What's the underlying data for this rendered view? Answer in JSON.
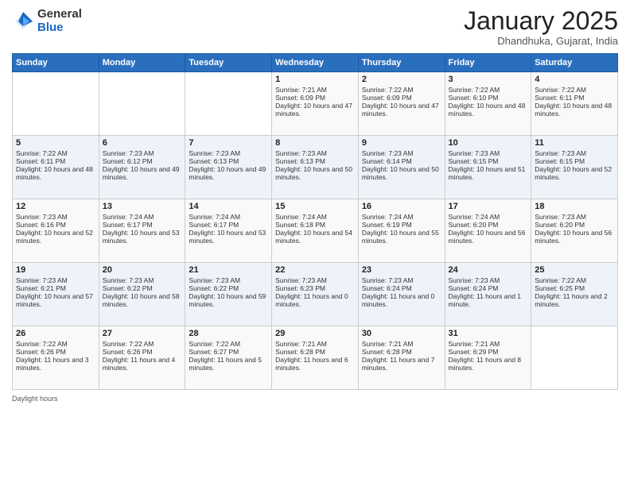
{
  "header": {
    "logo_general": "General",
    "logo_blue": "Blue",
    "month_title": "January 2025",
    "location": "Dhandhuka, Gujarat, India"
  },
  "weekdays": [
    "Sunday",
    "Monday",
    "Tuesday",
    "Wednesday",
    "Thursday",
    "Friday",
    "Saturday"
  ],
  "weeks": [
    [
      {
        "day": "",
        "sunrise": "",
        "sunset": "",
        "daylight": ""
      },
      {
        "day": "",
        "sunrise": "",
        "sunset": "",
        "daylight": ""
      },
      {
        "day": "",
        "sunrise": "",
        "sunset": "",
        "daylight": ""
      },
      {
        "day": "1",
        "sunrise": "Sunrise: 7:21 AM",
        "sunset": "Sunset: 6:09 PM",
        "daylight": "Daylight: 10 hours and 47 minutes."
      },
      {
        "day": "2",
        "sunrise": "Sunrise: 7:22 AM",
        "sunset": "Sunset: 6:09 PM",
        "daylight": "Daylight: 10 hours and 47 minutes."
      },
      {
        "day": "3",
        "sunrise": "Sunrise: 7:22 AM",
        "sunset": "Sunset: 6:10 PM",
        "daylight": "Daylight: 10 hours and 48 minutes."
      },
      {
        "day": "4",
        "sunrise": "Sunrise: 7:22 AM",
        "sunset": "Sunset: 6:11 PM",
        "daylight": "Daylight: 10 hours and 48 minutes."
      }
    ],
    [
      {
        "day": "5",
        "sunrise": "Sunrise: 7:22 AM",
        "sunset": "Sunset: 6:11 PM",
        "daylight": "Daylight: 10 hours and 48 minutes."
      },
      {
        "day": "6",
        "sunrise": "Sunrise: 7:23 AM",
        "sunset": "Sunset: 6:12 PM",
        "daylight": "Daylight: 10 hours and 49 minutes."
      },
      {
        "day": "7",
        "sunrise": "Sunrise: 7:23 AM",
        "sunset": "Sunset: 6:13 PM",
        "daylight": "Daylight: 10 hours and 49 minutes."
      },
      {
        "day": "8",
        "sunrise": "Sunrise: 7:23 AM",
        "sunset": "Sunset: 6:13 PM",
        "daylight": "Daylight: 10 hours and 50 minutes."
      },
      {
        "day": "9",
        "sunrise": "Sunrise: 7:23 AM",
        "sunset": "Sunset: 6:14 PM",
        "daylight": "Daylight: 10 hours and 50 minutes."
      },
      {
        "day": "10",
        "sunrise": "Sunrise: 7:23 AM",
        "sunset": "Sunset: 6:15 PM",
        "daylight": "Daylight: 10 hours and 51 minutes."
      },
      {
        "day": "11",
        "sunrise": "Sunrise: 7:23 AM",
        "sunset": "Sunset: 6:15 PM",
        "daylight": "Daylight: 10 hours and 52 minutes."
      }
    ],
    [
      {
        "day": "12",
        "sunrise": "Sunrise: 7:23 AM",
        "sunset": "Sunset: 6:16 PM",
        "daylight": "Daylight: 10 hours and 52 minutes."
      },
      {
        "day": "13",
        "sunrise": "Sunrise: 7:24 AM",
        "sunset": "Sunset: 6:17 PM",
        "daylight": "Daylight: 10 hours and 53 minutes."
      },
      {
        "day": "14",
        "sunrise": "Sunrise: 7:24 AM",
        "sunset": "Sunset: 6:17 PM",
        "daylight": "Daylight: 10 hours and 53 minutes."
      },
      {
        "day": "15",
        "sunrise": "Sunrise: 7:24 AM",
        "sunset": "Sunset: 6:18 PM",
        "daylight": "Daylight: 10 hours and 54 minutes."
      },
      {
        "day": "16",
        "sunrise": "Sunrise: 7:24 AM",
        "sunset": "Sunset: 6:19 PM",
        "daylight": "Daylight: 10 hours and 55 minutes."
      },
      {
        "day": "17",
        "sunrise": "Sunrise: 7:24 AM",
        "sunset": "Sunset: 6:20 PM",
        "daylight": "Daylight: 10 hours and 56 minutes."
      },
      {
        "day": "18",
        "sunrise": "Sunrise: 7:23 AM",
        "sunset": "Sunset: 6:20 PM",
        "daylight": "Daylight: 10 hours and 56 minutes."
      }
    ],
    [
      {
        "day": "19",
        "sunrise": "Sunrise: 7:23 AM",
        "sunset": "Sunset: 6:21 PM",
        "daylight": "Daylight: 10 hours and 57 minutes."
      },
      {
        "day": "20",
        "sunrise": "Sunrise: 7:23 AM",
        "sunset": "Sunset: 6:22 PM",
        "daylight": "Daylight: 10 hours and 58 minutes."
      },
      {
        "day": "21",
        "sunrise": "Sunrise: 7:23 AM",
        "sunset": "Sunset: 6:22 PM",
        "daylight": "Daylight: 10 hours and 59 minutes."
      },
      {
        "day": "22",
        "sunrise": "Sunrise: 7:23 AM",
        "sunset": "Sunset: 6:23 PM",
        "daylight": "Daylight: 11 hours and 0 minutes."
      },
      {
        "day": "23",
        "sunrise": "Sunrise: 7:23 AM",
        "sunset": "Sunset: 6:24 PM",
        "daylight": "Daylight: 11 hours and 0 minutes."
      },
      {
        "day": "24",
        "sunrise": "Sunrise: 7:23 AM",
        "sunset": "Sunset: 6:24 PM",
        "daylight": "Daylight: 11 hours and 1 minute."
      },
      {
        "day": "25",
        "sunrise": "Sunrise: 7:22 AM",
        "sunset": "Sunset: 6:25 PM",
        "daylight": "Daylight: 11 hours and 2 minutes."
      }
    ],
    [
      {
        "day": "26",
        "sunrise": "Sunrise: 7:22 AM",
        "sunset": "Sunset: 6:26 PM",
        "daylight": "Daylight: 11 hours and 3 minutes."
      },
      {
        "day": "27",
        "sunrise": "Sunrise: 7:22 AM",
        "sunset": "Sunset: 6:26 PM",
        "daylight": "Daylight: 11 hours and 4 minutes."
      },
      {
        "day": "28",
        "sunrise": "Sunrise: 7:22 AM",
        "sunset": "Sunset: 6:27 PM",
        "daylight": "Daylight: 11 hours and 5 minutes."
      },
      {
        "day": "29",
        "sunrise": "Sunrise: 7:21 AM",
        "sunset": "Sunset: 6:28 PM",
        "daylight": "Daylight: 11 hours and 6 minutes."
      },
      {
        "day": "30",
        "sunrise": "Sunrise: 7:21 AM",
        "sunset": "Sunset: 6:28 PM",
        "daylight": "Daylight: 11 hours and 7 minutes."
      },
      {
        "day": "31",
        "sunrise": "Sunrise: 7:21 AM",
        "sunset": "Sunset: 6:29 PM",
        "daylight": "Daylight: 11 hours and 8 minutes."
      },
      {
        "day": "",
        "sunrise": "",
        "sunset": "",
        "daylight": ""
      }
    ]
  ],
  "footer": {
    "daylight_label": "Daylight hours"
  }
}
